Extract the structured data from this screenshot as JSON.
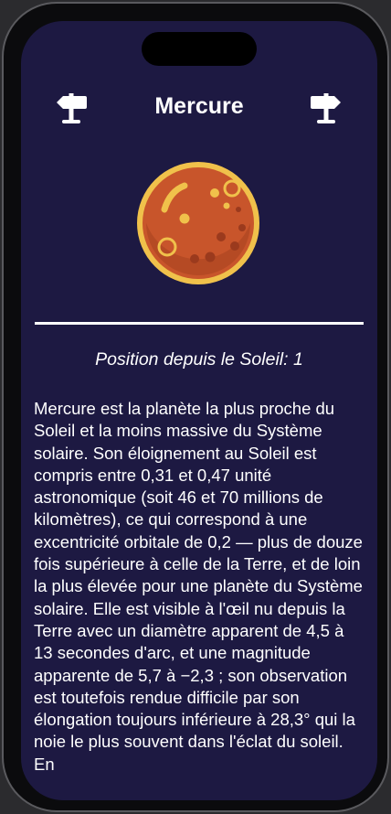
{
  "nav": {
    "title": "Mercure",
    "prev_icon": "signpost-left-icon",
    "next_icon": "signpost-right-icon"
  },
  "planet": {
    "icon": "mercury-planet-icon",
    "colors": {
      "body": "#c8552b",
      "rim": "#f0c14b",
      "spots": "#f0c14b",
      "craters": "#9b3a1d"
    }
  },
  "info": {
    "position_label": "Position depuis le Soleil:",
    "position_value": "1"
  },
  "description": "Mercure est la planète la plus proche du Soleil et la moins massive du Système solaire. Son éloignement au Soleil est compris entre 0,31 et 0,47 unité astronomique (soit 46 et 70 millions de kilomètres), ce qui correspond à une excentricité orbitale de 0,2 — plus de douze fois supérieure à celle de la Terre, et de loin la plus élevée pour une planète du Système solaire. Elle est visible à l'œil nu depuis la Terre avec un diamètre apparent de 4,5 à 13 secondes d'arc, et une magnitude apparente de 5,7 à −2,3 ; son observation est toutefois rendue difficile par son élongation toujours inférieure à 28,3° qui la noie le plus souvent dans l'éclat du soleil. En",
  "theme": {
    "background": "#1d1942",
    "text": "#ffffff"
  }
}
